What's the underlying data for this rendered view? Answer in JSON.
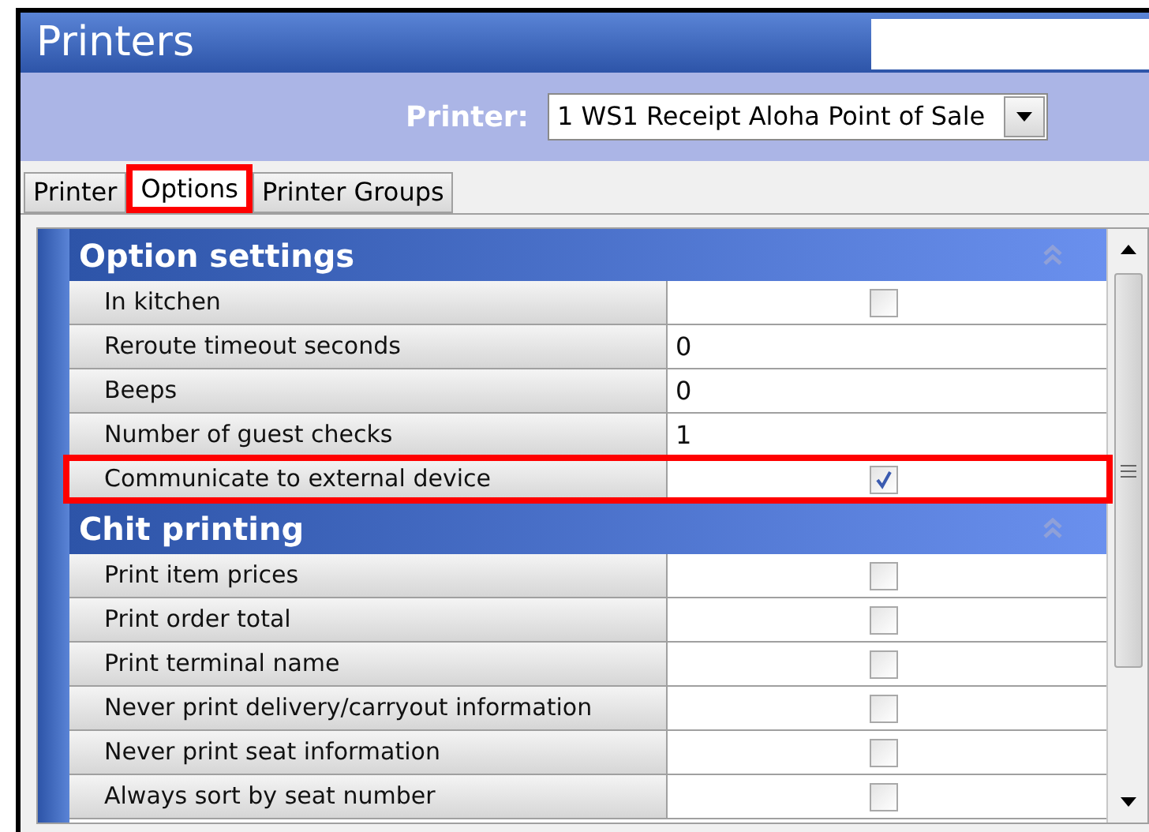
{
  "window": {
    "title": "Printers"
  },
  "printer_selector": {
    "label": "Printer:",
    "value": "1 WS1 Receipt Aloha Point of Sale"
  },
  "tabs": [
    {
      "label": "Printer",
      "selected": false,
      "highlighted": false
    },
    {
      "label": "Options",
      "selected": true,
      "highlighted": true
    },
    {
      "label": "Printer Groups",
      "selected": false,
      "highlighted": false
    }
  ],
  "sections": [
    {
      "title": "Option settings",
      "expanded": true,
      "rows": [
        {
          "label": "In kitchen",
          "kind": "checkbox",
          "checked": false,
          "highlighted": false
        },
        {
          "label": "Reroute timeout seconds",
          "kind": "text",
          "value": "0",
          "highlighted": false
        },
        {
          "label": "Beeps",
          "kind": "text",
          "value": "0",
          "highlighted": false
        },
        {
          "label": "Number of guest checks",
          "kind": "text",
          "value": "1",
          "highlighted": false
        },
        {
          "label": "Communicate to external device",
          "kind": "checkbox",
          "checked": true,
          "highlighted": true
        }
      ]
    },
    {
      "title": "Chit printing",
      "expanded": true,
      "rows": [
        {
          "label": "Print item prices",
          "kind": "checkbox",
          "checked": false,
          "highlighted": false
        },
        {
          "label": "Print order total",
          "kind": "checkbox",
          "checked": false,
          "highlighted": false
        },
        {
          "label": "Print terminal name",
          "kind": "checkbox",
          "checked": false,
          "highlighted": false
        },
        {
          "label": "Never print delivery/carryout information",
          "kind": "checkbox",
          "checked": false,
          "highlighted": false
        },
        {
          "label": "Never print seat information",
          "kind": "checkbox",
          "checked": false,
          "highlighted": false
        },
        {
          "label": "Always sort by seat number",
          "kind": "checkbox",
          "checked": false,
          "highlighted": false
        }
      ]
    }
  ]
}
